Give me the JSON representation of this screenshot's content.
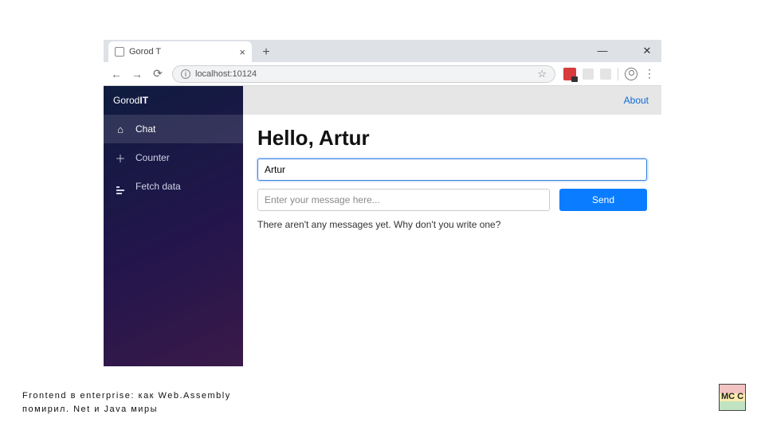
{
  "window": {
    "tab_title": "Gorod T",
    "minimize": "—",
    "close": "✕"
  },
  "address": {
    "url": "localhost:10124"
  },
  "sidebar": {
    "brand_prefix": "Gorod ",
    "brand_bold": "IT",
    "items": [
      {
        "icon": "home",
        "label": "Chat"
      },
      {
        "icon": "plus",
        "label": "Counter"
      },
      {
        "icon": "list",
        "label": "Fetch data"
      }
    ]
  },
  "topbar": {
    "about": "About"
  },
  "page": {
    "heading": "Hello, Artur",
    "name_value": "Artur",
    "message_placeholder": "Enter your message here...",
    "send_label": "Send",
    "empty_state": "There aren't any messages yet. Why don't you write one?"
  },
  "footer": {
    "line1": "Frontend в enterprise: как Web.Assembly",
    "line2": "помирил. Net и Java миры"
  },
  "logo": {
    "text": "MC\nC"
  }
}
